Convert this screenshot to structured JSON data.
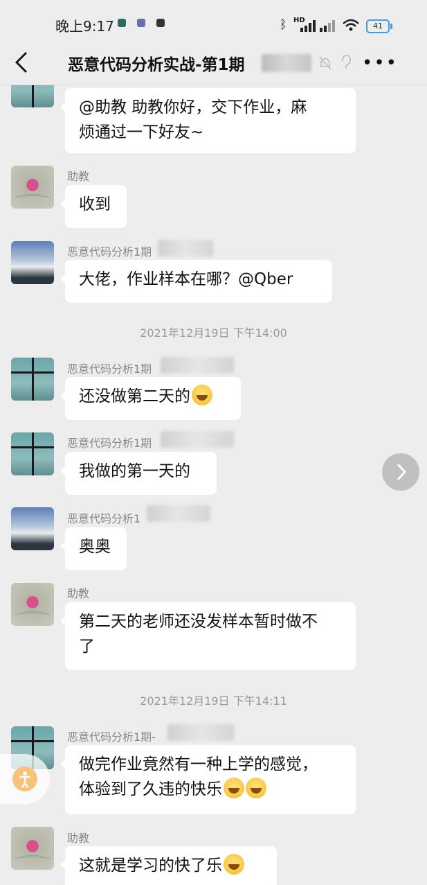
{
  "status_bar": {
    "time": "晚上9:17",
    "signal": "HD",
    "battery": "41"
  },
  "header": {
    "title": "恶意代码分析实战-第1期"
  },
  "messages": [
    {
      "sender": "",
      "text_lines": [
        "@助教  助教你好，交下作业，麻",
        "烦通过一下好友~"
      ]
    },
    {
      "sender": "助教",
      "text_lines": [
        "收到"
      ]
    },
    {
      "sender": "恶意代码分析1期",
      "text_lines": [
        "大佬，作业样本在哪？@Qber"
      ]
    },
    {
      "sender": "恶意代码分析1期",
      "text_lines": [
        "还没做第二天的"
      ]
    },
    {
      "sender": "恶意代码分析1期",
      "text_lines": [
        "我做的第一天的"
      ]
    },
    {
      "sender": "恶意代码分析1",
      "text_lines": [
        "奥奥"
      ]
    },
    {
      "sender": "助教",
      "text_lines": [
        "第二天的老师还没发样本暂时做不",
        "了"
      ]
    },
    {
      "sender": "恶意代码分析1期-",
      "text_lines": [
        "做完作业竟然有一种上学的感觉，",
        "体验到了久违的快乐"
      ]
    },
    {
      "sender": "助教",
      "text_lines": [
        "这就是学习的快了乐"
      ]
    }
  ],
  "timestamps": [
    "2021年12月19日 下午14:00",
    "2021年12月19日 下午14:11"
  ],
  "icons": [
    "back-arrow-icon",
    "mute-bell-icon",
    "earpiece-icon",
    "more-icon",
    "chevron-right-icon",
    "accessibility-icon"
  ],
  "colors": {
    "bubble": "#ffffff",
    "background": "#ededed",
    "battery": "#3ca0e0"
  }
}
